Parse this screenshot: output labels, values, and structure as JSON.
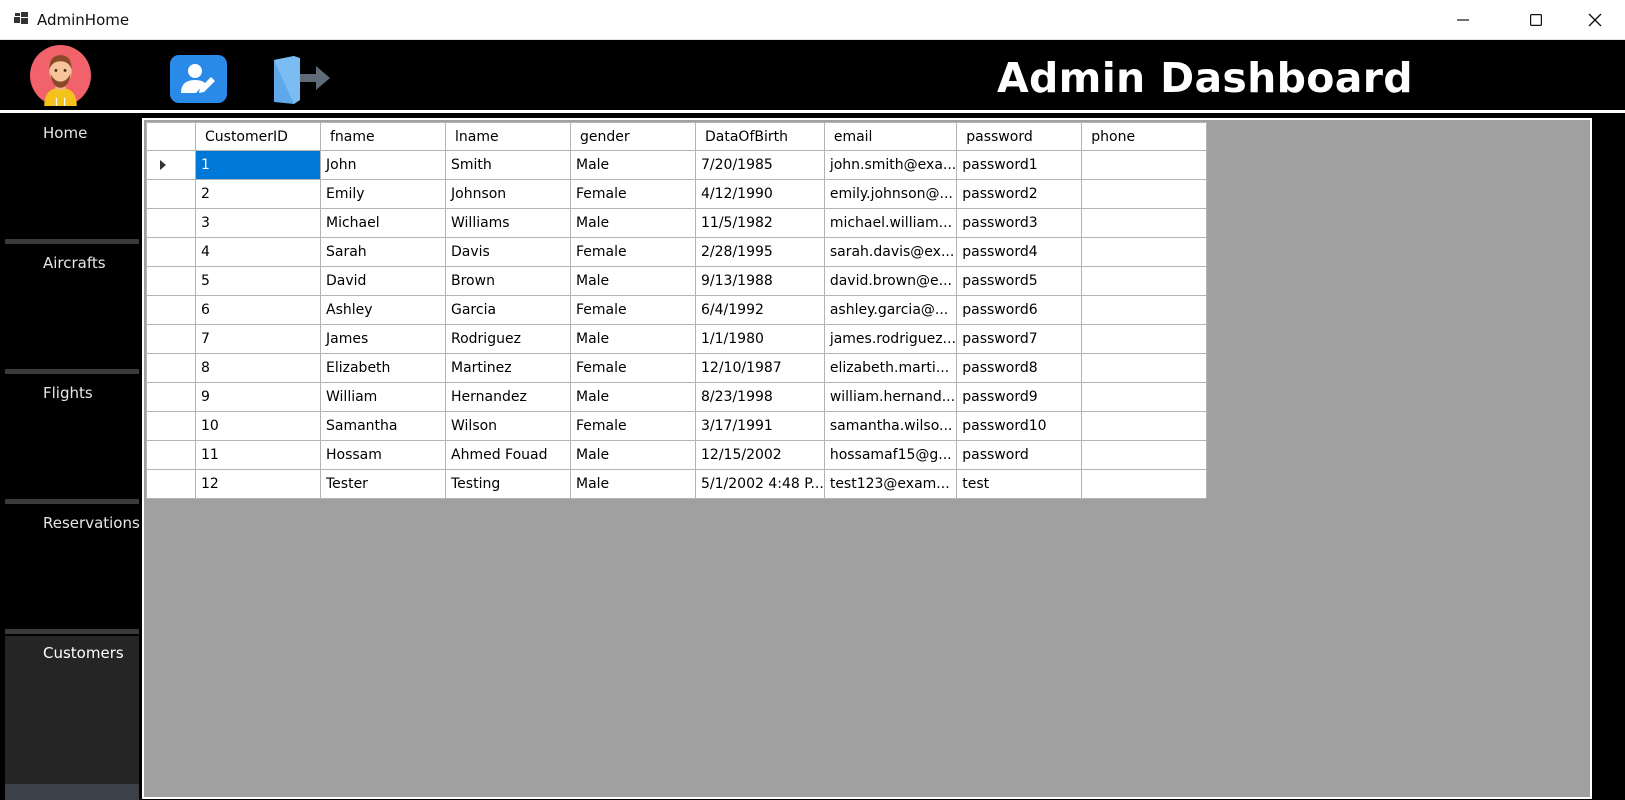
{
  "window": {
    "title": "AdminHome"
  },
  "header": {
    "title": "Admin Dashboard"
  },
  "sidebar": {
    "items": [
      {
        "label": "Home"
      },
      {
        "label": "Aircrafts"
      },
      {
        "label": "Flights"
      },
      {
        "label": "Reservations"
      },
      {
        "label": "Customers"
      }
    ],
    "active": "Customers"
  },
  "grid": {
    "columns": [
      "CustomerID",
      "fname",
      "lname",
      "gender",
      "DataOfBirth",
      "email",
      "password",
      "phone"
    ],
    "rows": [
      [
        "1",
        "John",
        "Smith",
        "Male",
        "7/20/1985",
        "john.smith@exa...",
        "password1",
        ""
      ],
      [
        "2",
        "Emily",
        "Johnson",
        "Female",
        "4/12/1990",
        "emily.johnson@...",
        "password2",
        ""
      ],
      [
        "3",
        "Michael",
        "Williams",
        "Male",
        "11/5/1982",
        "michael.william...",
        "password3",
        ""
      ],
      [
        "4",
        "Sarah",
        "Davis",
        "Female",
        "2/28/1995",
        "sarah.davis@ex...",
        "password4",
        ""
      ],
      [
        "5",
        "David",
        "Brown",
        "Male",
        "9/13/1988",
        "david.brown@e...",
        "password5",
        ""
      ],
      [
        "6",
        "Ashley",
        "Garcia",
        "Female",
        "6/4/1992",
        "ashley.garcia@...",
        "password6",
        ""
      ],
      [
        "7",
        "James",
        "Rodriguez",
        "Male",
        "1/1/1980",
        "james.rodriguez...",
        "password7",
        ""
      ],
      [
        "8",
        "Elizabeth",
        "Martinez",
        "Female",
        "12/10/1987",
        "elizabeth.marti...",
        "password8",
        ""
      ],
      [
        "9",
        "William",
        "Hernandez",
        "Male",
        "8/23/1998",
        "william.hernand...",
        "password9",
        ""
      ],
      [
        "10",
        "Samantha",
        "Wilson",
        "Female",
        "3/17/1991",
        "samantha.wilso...",
        "password10",
        ""
      ],
      [
        "11",
        "Hossam",
        "Ahmed Fouad",
        "Male",
        "12/15/2002",
        "hossamaf15@g...",
        "password",
        ""
      ],
      [
        "12",
        "Tester",
        "Testing",
        "Male",
        "5/1/2002 4:48 P...",
        "test123@exam...",
        "test",
        ""
      ]
    ],
    "selected_cell": {
      "row": 0,
      "col": 0
    }
  },
  "colors": {
    "background": "#000000",
    "grid_empty": "#a0a0a0",
    "selection": "#0078d7",
    "edit_button": "#2a8ae8",
    "active_sidebar": "#252526"
  },
  "icons": {
    "app": "windows-form-icon",
    "avatar": "avatar-icon",
    "edit_profile": "user-edit-icon",
    "logout": "logout-icon"
  }
}
